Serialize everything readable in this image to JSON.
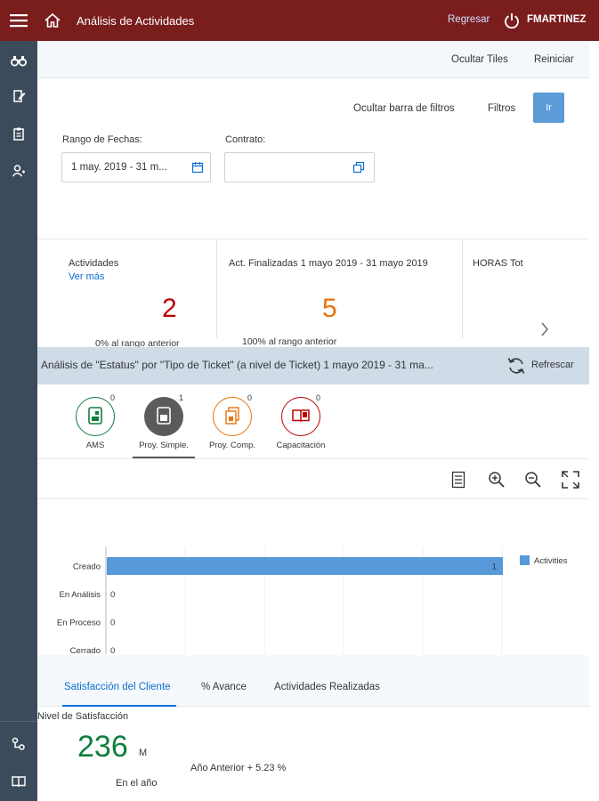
{
  "header": {
    "title": "Análisis de Actividades",
    "back": "Regresar",
    "user": "FMARTINEZ"
  },
  "page_bar": {
    "hide_tiles": "Ocultar Tiles",
    "reset": "Reiniciar"
  },
  "filters": {
    "hide_bar": "Ocultar barra de filtros",
    "filters": "Filtros",
    "go": "Ir",
    "date_label": "Rango de Fechas:",
    "date_value": "1 may. 2019 - 31 m...",
    "contract_label": "Contrato:",
    "contract_value": ""
  },
  "tiles": [
    {
      "title": "Actividades",
      "link": "Ver más",
      "value": "2",
      "value_color": "#bb0000",
      "sub": "0% al rango anterior"
    },
    {
      "title": "Act. Finalizadas 1 mayo 2019 - 31 mayo 2019",
      "value": "5",
      "value_color": "#e9730c",
      "sub": "100% al rango anterior"
    },
    {
      "title": "HORAS Tot"
    }
  ],
  "analysis": {
    "title": "Análisis de \"Estatus\" por \"Tipo de Ticket\" (a nivel de Ticket) 1 mayo 2019 - 31 ma...",
    "refresh": "Refrescar"
  },
  "ticket_types": [
    {
      "label": "AMS",
      "count": "0",
      "color": "#107e3e",
      "icon": "document-icon"
    },
    {
      "label": "Proy. Simple.",
      "count": "1",
      "color": "#5b5b5b",
      "icon": "document-icon"
    },
    {
      "label": "Proy. Comp.",
      "count": "0",
      "color": "#e9730c",
      "icon": "copy-document-icon"
    },
    {
      "label": "Capacitación",
      "count": "0",
      "color": "#bb0000",
      "icon": "open-book-icon"
    }
  ],
  "chart_data": {
    "type": "bar",
    "orientation": "horizontal",
    "categories": [
      "Creado",
      "En Análisis",
      "En Proceso",
      "Cerrado"
    ],
    "series": [
      {
        "name": "Activities",
        "values": [
          1,
          0,
          0,
          0
        ],
        "color": "#5899da"
      }
    ],
    "xlim": [
      0,
      1
    ],
    "xticks": [
      "0",
      "0.2",
      "0.4",
      "0.6",
      "0.8",
      "1"
    ],
    "data_labels": [
      "1",
      "0",
      "0",
      "0"
    ],
    "legend": "top-right"
  },
  "bottom_tabs": [
    {
      "label": "Satisfacción del Cliente",
      "active": true
    },
    {
      "label": "% Avance",
      "active": false
    },
    {
      "label": "Actividades Realizadas",
      "active": false
    }
  ],
  "satisfaction": {
    "label": "Nivel de Satisfacción",
    "value": "236",
    "unit": "M",
    "caption": "En el año",
    "comparison": "Año Anterior + 5.23 %",
    "value_color": "#107e3e"
  }
}
